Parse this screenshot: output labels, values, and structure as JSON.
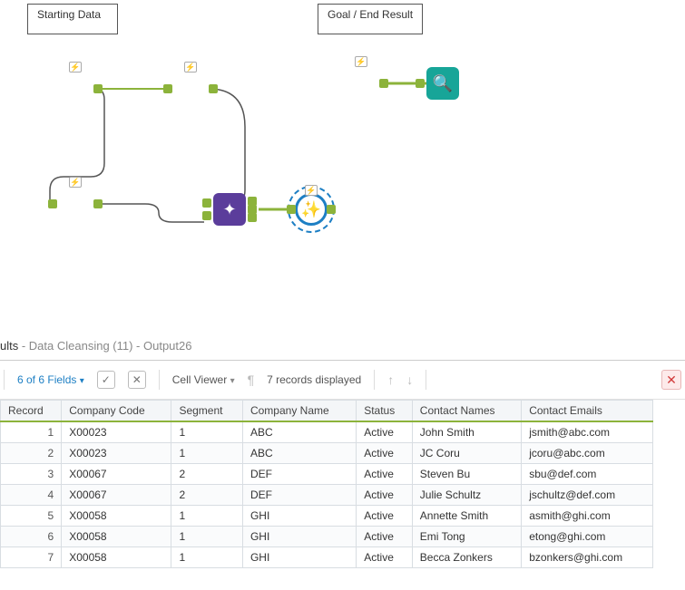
{
  "canvas": {
    "label_start": "Starting Data",
    "label_goal": "Goal / End Result"
  },
  "results": {
    "tab": "ults",
    "subtitle": " - Data Cleansing (11) - Output26"
  },
  "toolbar": {
    "fields": "6 of 6 Fields",
    "viewer": "Cell Viewer",
    "count": "7 records displayed"
  },
  "columns": [
    "Record",
    "Company Code",
    "Segment",
    "Company Name",
    "Status",
    "Contact Names",
    "Contact Emails"
  ],
  "rows": [
    {
      "Record": "1",
      "Company Code": "X00023",
      "Segment": "1",
      "Company Name": "ABC",
      "Status": "Active",
      "Contact Names": "John Smith",
      "Contact Emails": "jsmith@abc.com"
    },
    {
      "Record": "2",
      "Company Code": "X00023",
      "Segment": "1",
      "Company Name": "ABC",
      "Status": "Active",
      "Contact Names": "JC Coru",
      "Contact Emails": "jcoru@abc.com"
    },
    {
      "Record": "3",
      "Company Code": "X00067",
      "Segment": "2",
      "Company Name": "DEF",
      "Status": "Active",
      "Contact Names": "Steven Bu",
      "Contact Emails": "sbu@def.com"
    },
    {
      "Record": "4",
      "Company Code": "X00067",
      "Segment": "2",
      "Company Name": "DEF",
      "Status": "Active",
      "Contact Names": "Julie Schultz",
      "Contact Emails": "jschultz@def.com"
    },
    {
      "Record": "5",
      "Company Code": "X00058",
      "Segment": "1",
      "Company Name": "GHI",
      "Status": "Active",
      "Contact Names": "Annette Smith",
      "Contact Emails": "asmith@ghi.com"
    },
    {
      "Record": "6",
      "Company Code": "X00058",
      "Segment": "1",
      "Company Name": "GHI",
      "Status": "Active",
      "Contact Names": "Emi Tong",
      "Contact Emails": "etong@ghi.com"
    },
    {
      "Record": "7",
      "Company Code": "X00058",
      "Segment": "1",
      "Company Name": "GHI",
      "Status": "Active",
      "Contact Names": "Becca Zonkers",
      "Contact Emails": "bzonkers@ghi.com"
    }
  ]
}
